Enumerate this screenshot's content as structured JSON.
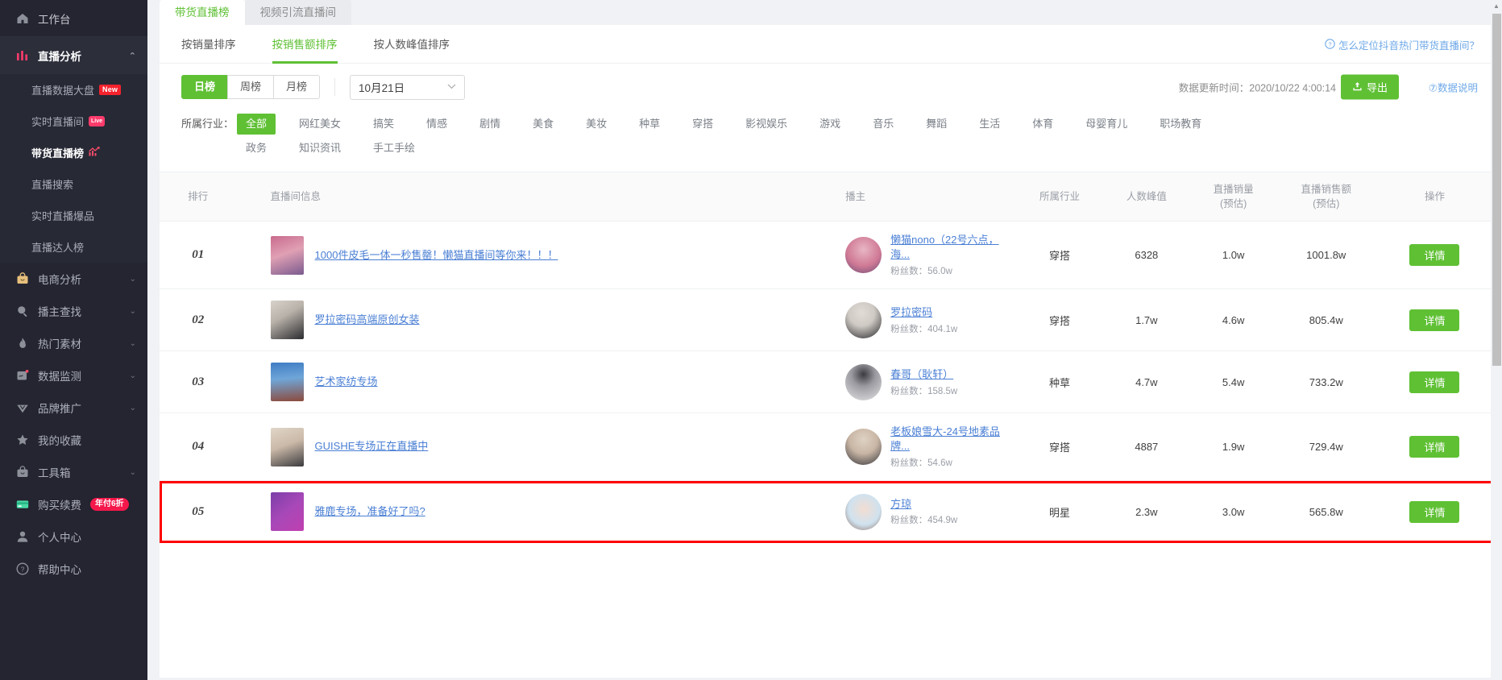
{
  "sidebar": {
    "home": {
      "label": "工作台",
      "icon": "home-icon"
    },
    "group": {
      "label": "直播分析",
      "icon": "bar-chart-icon",
      "caret": "⌃"
    },
    "sub_items": [
      {
        "label": "直播数据大盘",
        "badge": "New"
      },
      {
        "label": "实时直播间",
        "badge": "Live"
      },
      {
        "label": "带货直播榜",
        "badge": ""
      },
      {
        "label": "直播搜索",
        "badge": ""
      },
      {
        "label": "实时直播爆品",
        "badge": ""
      },
      {
        "label": "直播达人榜",
        "badge": ""
      }
    ],
    "items": [
      {
        "label": "电商分析",
        "icon": "bag-icon",
        "caret": "⌄"
      },
      {
        "label": "播主查找",
        "icon": "search-icon",
        "caret": "⌄"
      },
      {
        "label": "热门素材",
        "icon": "fire-icon",
        "caret": "⌄"
      },
      {
        "label": "数据监测",
        "icon": "monitor-icon",
        "caret": "⌄"
      },
      {
        "label": "品牌推广",
        "icon": "diamond-icon",
        "caret": "⌄"
      },
      {
        "label": "我的收藏",
        "icon": "star-icon",
        "caret": ""
      },
      {
        "label": "工具箱",
        "icon": "toolbox-icon",
        "caret": "⌄"
      },
      {
        "label": "购买续费",
        "icon": "card-icon",
        "caret": "",
        "badge": "年付6折"
      },
      {
        "label": "个人中心",
        "icon": "user-icon",
        "caret": ""
      },
      {
        "label": "帮助中心",
        "icon": "help-icon",
        "caret": ""
      }
    ]
  },
  "tabs": [
    {
      "label": "带货直播榜",
      "active": true
    },
    {
      "label": "视频引流直播间",
      "active": false
    }
  ],
  "sort_tabs": [
    {
      "label": "按销量排序",
      "active": false
    },
    {
      "label": "按销售额排序",
      "active": true
    },
    {
      "label": "按人数峰值排序",
      "active": false
    }
  ],
  "howto_link": {
    "icon": "question-circle-icon",
    "label": "怎么定位抖音热门带货直播间？"
  },
  "period": [
    {
      "label": "日榜",
      "active": true
    },
    {
      "label": "周榜",
      "active": false
    },
    {
      "label": "月榜",
      "active": false
    }
  ],
  "date_select": {
    "value": "10月21日",
    "chevron": "⌄"
  },
  "updated_text": "数据更新时间：2020/10/22 4:00:14",
  "export_button": {
    "label": "导出",
    "icon": "upload-icon"
  },
  "data_desc_link": "⑦数据说明",
  "industry": {
    "label": "所属行业：",
    "tags": [
      "全部",
      "网红美女",
      "搞笑",
      "情感",
      "剧情",
      "美食",
      "美妆",
      "种草",
      "穿搭",
      "影视娱乐",
      "游戏",
      "音乐",
      "舞蹈",
      "生活",
      "体育",
      "母婴育儿",
      "职场教育",
      "政务",
      "知识资讯",
      "手工手绘"
    ],
    "active": "全部"
  },
  "table": {
    "headers": [
      "排行",
      "直播间信息",
      "播主",
      "所属行业",
      "人数峰值",
      "直播销量\n(预估)",
      "直播销售额\n(预估)",
      "操作"
    ],
    "headers_multiline": [
      {
        "line1": "排行",
        "line2": ""
      },
      {
        "line1": "直播间信息",
        "line2": ""
      },
      {
        "line1": "播主",
        "line2": ""
      },
      {
        "line1": "所属行业",
        "line2": ""
      },
      {
        "line1": "人数峰值",
        "line2": ""
      },
      {
        "line1": "直播销量",
        "line2": "(预估)"
      },
      {
        "line1": "直播销售额",
        "line2": "(预估)"
      },
      {
        "line1": "操作",
        "line2": ""
      }
    ],
    "action_label": "详情",
    "fans_prefix": "粉丝数：",
    "rows": [
      {
        "rank": "01",
        "room_title": "1000件皮毛一体一秒售罄！懒猫直播间等你来！！！",
        "host_name": "懒猫nono（22号六点，海...",
        "fans": "56.0w",
        "industry": "穿搭",
        "peak": "6328",
        "volume": "1.0w",
        "amount": "1001.8w",
        "highlight": false,
        "thumb_colors": [
          "#c86b8d",
          "#7a5a8e"
        ],
        "avatar_colors": [
          "#d07a96",
          "#6b4c74"
        ]
      },
      {
        "rank": "02",
        "room_title": "罗拉密码高端原创女装",
        "host_name": "罗拉密码",
        "fans": "404.1w",
        "industry": "穿搭",
        "peak": "1.7w",
        "volume": "4.6w",
        "amount": "805.4w",
        "highlight": false,
        "thumb_colors": [
          "#d8d2cc",
          "#2b2b2f"
        ],
        "avatar_colors": [
          "#cfcac4",
          "#26262a"
        ]
      },
      {
        "rank": "03",
        "room_title": "艺术家纺专场",
        "host_name": "春哥（耿轩）",
        "fans": "158.5w",
        "industry": "种草",
        "peak": "4.7w",
        "volume": "5.4w",
        "amount": "733.2w",
        "highlight": false,
        "thumb_colors": [
          "#3f7cc4",
          "#8c4a3c"
        ],
        "avatar_colors": [
          "#e4e4e6",
          "#3a3a40"
        ]
      },
      {
        "rank": "04",
        "room_title": "GUISHE专场正在直播中",
        "host_name": "老板娘雪大-24号地素品牌...",
        "fans": "54.6w",
        "industry": "穿搭",
        "peak": "4887",
        "volume": "1.9w",
        "amount": "729.4w",
        "highlight": false,
        "thumb_colors": [
          "#cbb9a8",
          "#3a3a3e"
        ],
        "avatar_colors": [
          "#c9b6a5",
          "#35353a"
        ]
      },
      {
        "rank": "05",
        "room_title": "雅鹿专场，准备好了吗?",
        "host_name": "方琼",
        "fans": "454.9w",
        "industry": "明星",
        "peak": "2.3w",
        "volume": "3.0w",
        "amount": "565.8w",
        "highlight": true,
        "thumb_colors": [
          "#7b3fa8",
          "#c03fb0"
        ],
        "avatar_colors": [
          "#cfe2ef",
          "#8c6a5a"
        ]
      }
    ]
  },
  "colors": {
    "accent_green": "#5fc034",
    "link_blue": "#4a7fd4",
    "sidebar_bg": "#242531",
    "highlight_red": "#ff0000"
  }
}
